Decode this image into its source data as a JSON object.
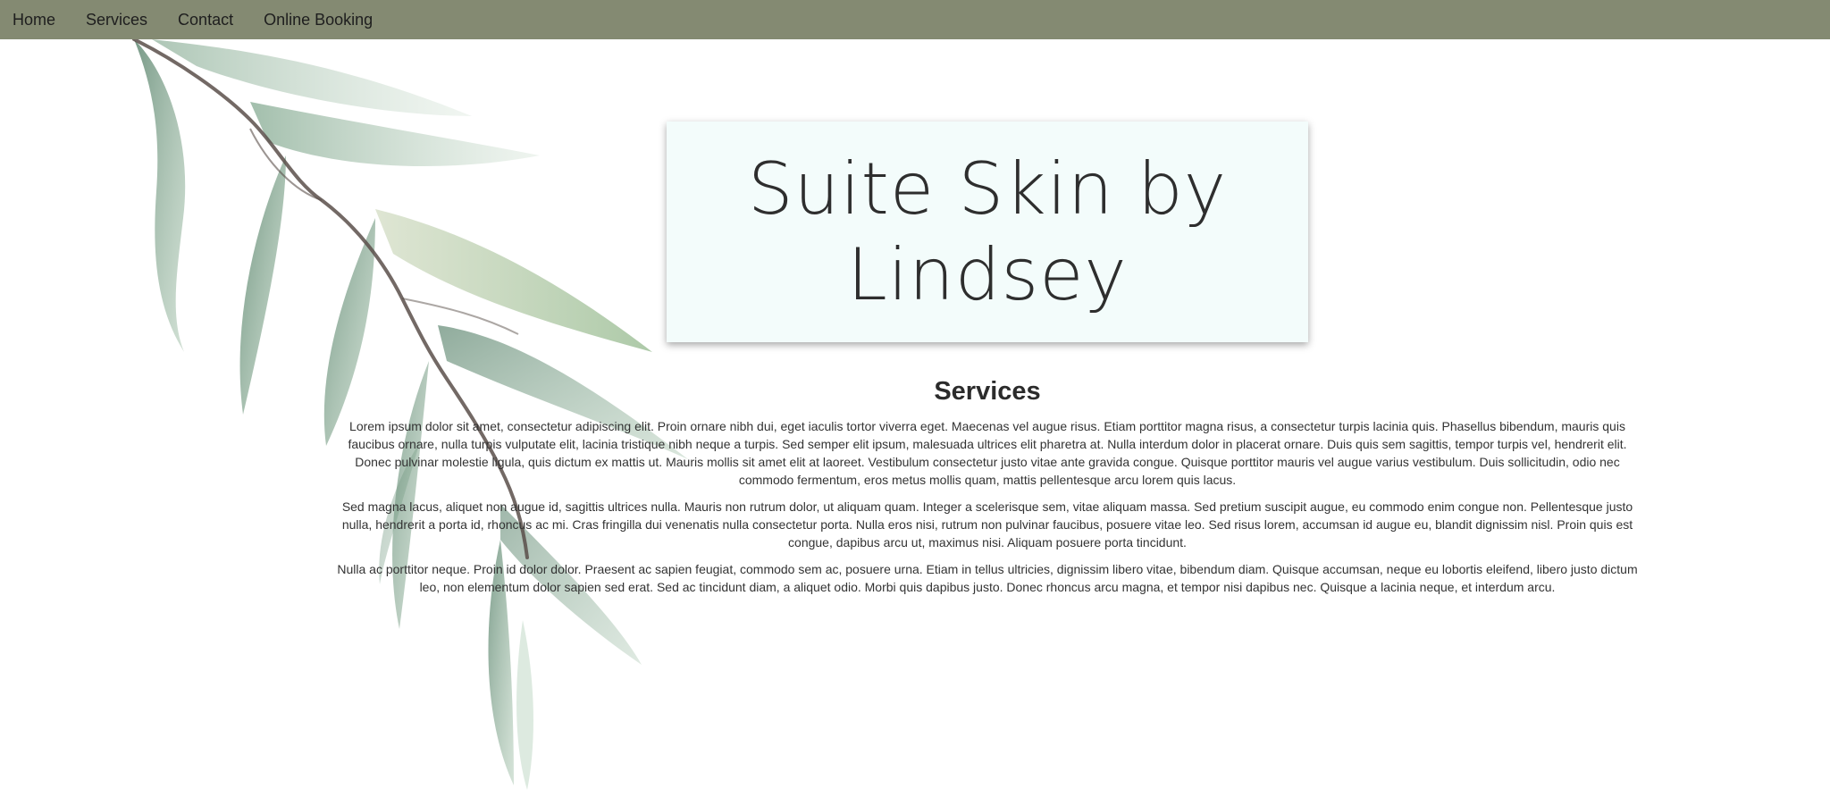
{
  "nav": {
    "items": [
      {
        "label": "Home"
      },
      {
        "label": "Services"
      },
      {
        "label": "Contact"
      },
      {
        "label": "Online Booking"
      }
    ],
    "background_color": "#848a72"
  },
  "header": {
    "title": "Suite Skin by Lindsey"
  },
  "services": {
    "heading": "Services",
    "paragraphs": [
      "Lorem ipsum dolor sit amet, consectetur adipiscing elit. Proin ornare nibh dui, eget iaculis tortor viverra eget. Maecenas vel augue risus. Etiam porttitor magna risus, a consectetur turpis lacinia quis. Phasellus bibendum, mauris quis faucibus ornare, nulla turpis vulputate elit, lacinia tristique nibh neque a turpis. Sed semper elit ipsum, malesuada ultrices elit pharetra at. Nulla interdum dolor in placerat ornare. Duis quis sem sagittis, tempor turpis vel, hendrerit elit. Donec pulvinar molestie ligula, quis dictum ex mattis ut. Mauris mollis sit amet elit at laoreet. Vestibulum consectetur justo vitae ante gravida congue. Quisque porttitor mauris vel augue varius vestibulum. Duis sollicitudin, odio nec commodo fermentum, eros metus mollis quam, mattis pellentesque arcu lorem quis lacus.",
      "Sed magna lacus, aliquet non augue id, sagittis ultrices nulla. Mauris non rutrum dolor, ut aliquam quam. Integer a scelerisque sem, vitae aliquam massa. Sed pretium suscipit augue, eu commodo enim congue non. Pellentesque justo nulla, hendrerit a porta id, rhoncus ac mi. Cras fringilla dui venenatis nulla consectetur porta. Nulla eros nisi, rutrum non pulvinar faucibus, posuere vitae leo. Sed risus lorem, accumsan id augue eu, blandit dignissim nisl. Proin quis est congue, dapibus arcu ut, maximus nisi. Aliquam posuere porta tincidunt.",
      "Nulla ac porttitor neque. Proin id dolor dolor. Praesent ac sapien feugiat, commodo sem ac, posuere urna. Etiam in tellus ultricies, dignissim libero vitae, bibendum diam. Quisque accumsan, neque eu lobortis eleifend, libero justo dictum leo, non elementum dolor sapien sed erat. Sed ac tincidunt diam, a aliquet odio. Morbi quis dapibus justo. Donec rhoncus arcu magna, et tempor nisi dapibus nec. Quisque a lacinia neque, et interdum arcu."
    ]
  },
  "decoration": {
    "icon": "eucalyptus-branch-icon",
    "leaf_color": "#5f8a6c",
    "stem_color": "#5a4f4a"
  }
}
